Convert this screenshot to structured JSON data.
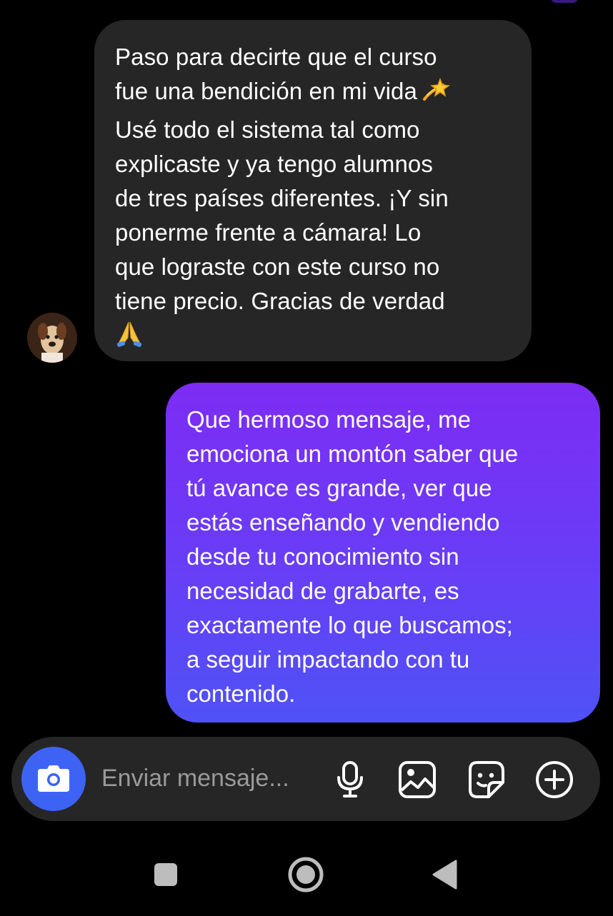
{
  "conversation": {
    "incoming": {
      "text": "Paso para decirte que el curso\nfue una bendición en mi vida",
      "emoji_1": "💫",
      "text_2": "\nUsé todo el sistema tal como\nexplicaste y ya tengo alumnos\nde tres países diferentes. ¡Y sin\nponerme frente a cámara! Lo\nque lograste con este curso no\ntiene precio. Gracias de verdad\n",
      "emoji_2": "🙏",
      "avatar_icon": "avatar-photo-dog"
    },
    "outgoing": {
      "text": "Que hermoso mensaje, me\nemociona un montón saber que\ntú avance es grande, ver que\nestás enseñando y vendiendo\ndesde tu conocimiento sin\nnecesidad de grabarte, es\nexactamente lo que buscamos;\na seguir impactando con tu\ncontenido."
    }
  },
  "composer": {
    "placeholder": "Enviar mensaje...",
    "icons": [
      "camera-icon",
      "microphone-icon",
      "gallery-icon",
      "sticker-icon",
      "add-icon"
    ]
  },
  "navbar": {
    "icons": [
      "recents-icon",
      "home-icon",
      "back-icon"
    ]
  },
  "colors": {
    "background": "#000000",
    "incoming_bubble": "#262626",
    "outgoing_gradient_top": "#7d2cf4",
    "outgoing_gradient_bottom": "#4f52f6",
    "camera_button": "#3d63f5",
    "placeholder": "#9a9a9a"
  }
}
